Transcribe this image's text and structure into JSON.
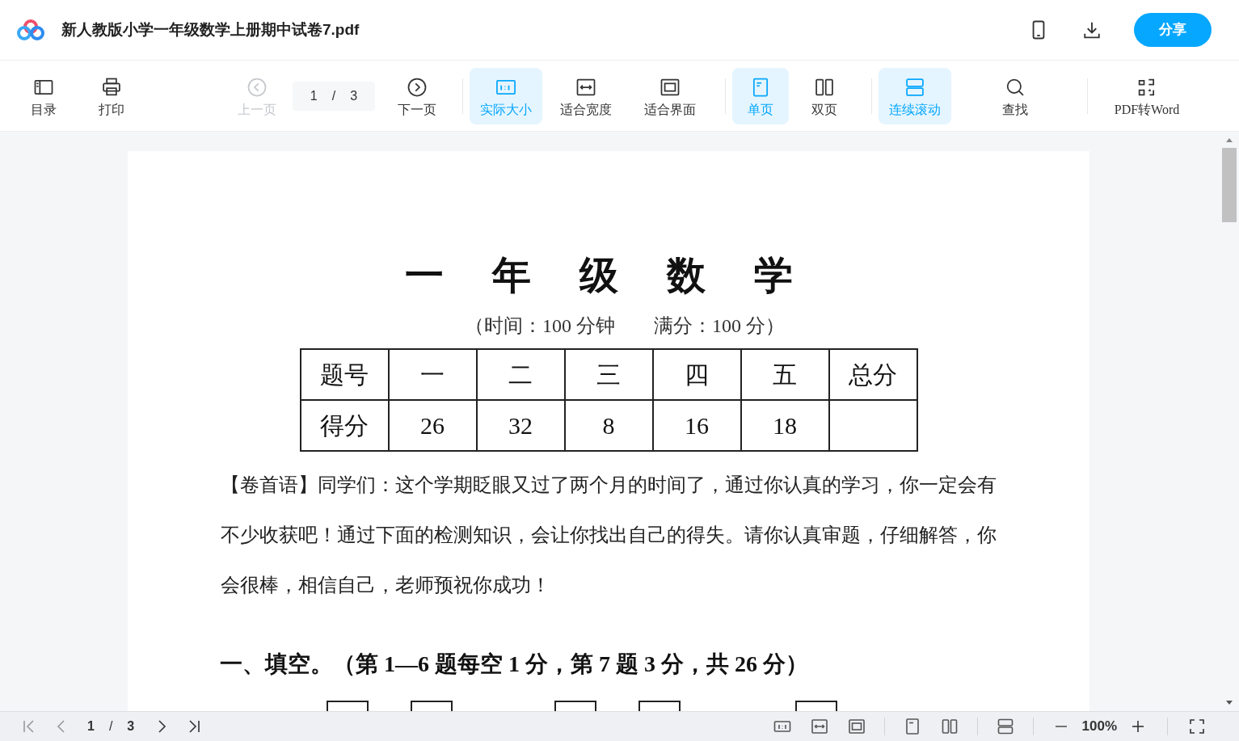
{
  "header": {
    "title": "新人教版小学一年级数学上册期中试卷7.pdf",
    "share_button": "分享"
  },
  "toolbar": {
    "groups": [
      [
        {
          "label": "目录",
          "selected": false,
          "disabled": false
        },
        {
          "label": "打印",
          "selected": false,
          "disabled": false
        }
      ],
      [
        {
          "label": "上一页",
          "selected": false,
          "disabled": true
        },
        {
          "kind": "pager",
          "current": "1",
          "separator": "/",
          "total": "3"
        },
        {
          "label": "下一页",
          "selected": false,
          "disabled": false
        }
      ],
      [
        {
          "label": "实际大小",
          "selected": true,
          "disabled": false
        },
        {
          "label": "适合宽度",
          "selected": false,
          "disabled": false
        },
        {
          "label": "适合界面",
          "selected": false,
          "disabled": false
        }
      ],
      [
        {
          "label": "单页",
          "selected": true,
          "disabled": false
        },
        {
          "label": "双页",
          "selected": false,
          "disabled": false
        }
      ],
      [
        {
          "label": "连续滚动",
          "selected": true,
          "disabled": false
        },
        {
          "label": "查找",
          "selected": false,
          "disabled": false
        }
      ],
      [
        {
          "label": "PDF转Word",
          "selected": false,
          "disabled": false
        }
      ]
    ]
  },
  "document": {
    "title": "一 年 级 数 学",
    "subtitle": "（时间：100 分钟　　满分：100 分）",
    "score_table": {
      "rows": [
        [
          "题号",
          "一",
          "二",
          "三",
          "四",
          "五",
          "总分"
        ],
        [
          "得分",
          "26",
          "32",
          "8",
          "16",
          "18",
          ""
        ]
      ]
    },
    "intro": "【卷首语】同学们：这个学期眨眼又过了两个月的时间了，通过你认真的学习，你一定会有不少收获吧！通过下面的检测知识，会让你找出自己的得失。请你认真审题，仔细解答，你会很棒，相信自己，老师预祝你成功！",
    "section_heading": "一、填空。（第 1—6 题每空 1 分，第 7 题 3 分，共 26 分）"
  },
  "status_bar": {
    "current": "1",
    "separator": "/",
    "total": "3",
    "zoom": "100%"
  }
}
